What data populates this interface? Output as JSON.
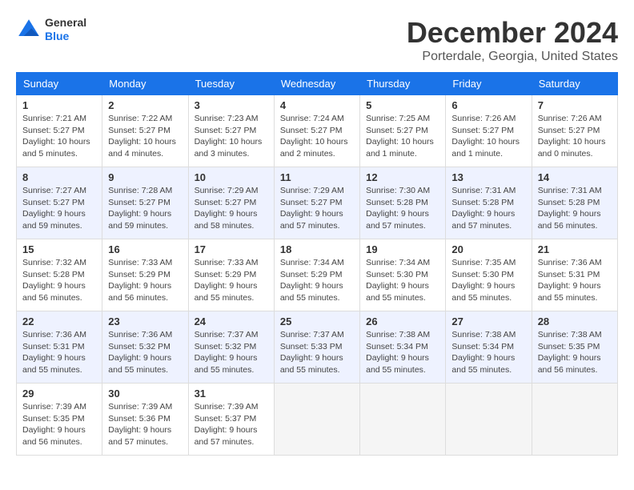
{
  "header": {
    "logo_line1": "General",
    "logo_line2": "Blue",
    "month_title": "December 2024",
    "location": "Porterdale, Georgia, United States"
  },
  "days_of_week": [
    "Sunday",
    "Monday",
    "Tuesday",
    "Wednesday",
    "Thursday",
    "Friday",
    "Saturday"
  ],
  "weeks": [
    [
      {
        "day": "1",
        "sunrise": "Sunrise: 7:21 AM",
        "sunset": "Sunset: 5:27 PM",
        "daylight": "Daylight: 10 hours and 5 minutes."
      },
      {
        "day": "2",
        "sunrise": "Sunrise: 7:22 AM",
        "sunset": "Sunset: 5:27 PM",
        "daylight": "Daylight: 10 hours and 4 minutes."
      },
      {
        "day": "3",
        "sunrise": "Sunrise: 7:23 AM",
        "sunset": "Sunset: 5:27 PM",
        "daylight": "Daylight: 10 hours and 3 minutes."
      },
      {
        "day": "4",
        "sunrise": "Sunrise: 7:24 AM",
        "sunset": "Sunset: 5:27 PM",
        "daylight": "Daylight: 10 hours and 2 minutes."
      },
      {
        "day": "5",
        "sunrise": "Sunrise: 7:25 AM",
        "sunset": "Sunset: 5:27 PM",
        "daylight": "Daylight: 10 hours and 1 minute."
      },
      {
        "day": "6",
        "sunrise": "Sunrise: 7:26 AM",
        "sunset": "Sunset: 5:27 PM",
        "daylight": "Daylight: 10 hours and 1 minute."
      },
      {
        "day": "7",
        "sunrise": "Sunrise: 7:26 AM",
        "sunset": "Sunset: 5:27 PM",
        "daylight": "Daylight: 10 hours and 0 minutes."
      }
    ],
    [
      {
        "day": "8",
        "sunrise": "Sunrise: 7:27 AM",
        "sunset": "Sunset: 5:27 PM",
        "daylight": "Daylight: 9 hours and 59 minutes."
      },
      {
        "day": "9",
        "sunrise": "Sunrise: 7:28 AM",
        "sunset": "Sunset: 5:27 PM",
        "daylight": "Daylight: 9 hours and 59 minutes."
      },
      {
        "day": "10",
        "sunrise": "Sunrise: 7:29 AM",
        "sunset": "Sunset: 5:27 PM",
        "daylight": "Daylight: 9 hours and 58 minutes."
      },
      {
        "day": "11",
        "sunrise": "Sunrise: 7:29 AM",
        "sunset": "Sunset: 5:27 PM",
        "daylight": "Daylight: 9 hours and 57 minutes."
      },
      {
        "day": "12",
        "sunrise": "Sunrise: 7:30 AM",
        "sunset": "Sunset: 5:28 PM",
        "daylight": "Daylight: 9 hours and 57 minutes."
      },
      {
        "day": "13",
        "sunrise": "Sunrise: 7:31 AM",
        "sunset": "Sunset: 5:28 PM",
        "daylight": "Daylight: 9 hours and 57 minutes."
      },
      {
        "day": "14",
        "sunrise": "Sunrise: 7:31 AM",
        "sunset": "Sunset: 5:28 PM",
        "daylight": "Daylight: 9 hours and 56 minutes."
      }
    ],
    [
      {
        "day": "15",
        "sunrise": "Sunrise: 7:32 AM",
        "sunset": "Sunset: 5:28 PM",
        "daylight": "Daylight: 9 hours and 56 minutes."
      },
      {
        "day": "16",
        "sunrise": "Sunrise: 7:33 AM",
        "sunset": "Sunset: 5:29 PM",
        "daylight": "Daylight: 9 hours and 56 minutes."
      },
      {
        "day": "17",
        "sunrise": "Sunrise: 7:33 AM",
        "sunset": "Sunset: 5:29 PM",
        "daylight": "Daylight: 9 hours and 55 minutes."
      },
      {
        "day": "18",
        "sunrise": "Sunrise: 7:34 AM",
        "sunset": "Sunset: 5:29 PM",
        "daylight": "Daylight: 9 hours and 55 minutes."
      },
      {
        "day": "19",
        "sunrise": "Sunrise: 7:34 AM",
        "sunset": "Sunset: 5:30 PM",
        "daylight": "Daylight: 9 hours and 55 minutes."
      },
      {
        "day": "20",
        "sunrise": "Sunrise: 7:35 AM",
        "sunset": "Sunset: 5:30 PM",
        "daylight": "Daylight: 9 hours and 55 minutes."
      },
      {
        "day": "21",
        "sunrise": "Sunrise: 7:36 AM",
        "sunset": "Sunset: 5:31 PM",
        "daylight": "Daylight: 9 hours and 55 minutes."
      }
    ],
    [
      {
        "day": "22",
        "sunrise": "Sunrise: 7:36 AM",
        "sunset": "Sunset: 5:31 PM",
        "daylight": "Daylight: 9 hours and 55 minutes."
      },
      {
        "day": "23",
        "sunrise": "Sunrise: 7:36 AM",
        "sunset": "Sunset: 5:32 PM",
        "daylight": "Daylight: 9 hours and 55 minutes."
      },
      {
        "day": "24",
        "sunrise": "Sunrise: 7:37 AM",
        "sunset": "Sunset: 5:32 PM",
        "daylight": "Daylight: 9 hours and 55 minutes."
      },
      {
        "day": "25",
        "sunrise": "Sunrise: 7:37 AM",
        "sunset": "Sunset: 5:33 PM",
        "daylight": "Daylight: 9 hours and 55 minutes."
      },
      {
        "day": "26",
        "sunrise": "Sunrise: 7:38 AM",
        "sunset": "Sunset: 5:34 PM",
        "daylight": "Daylight: 9 hours and 55 minutes."
      },
      {
        "day": "27",
        "sunrise": "Sunrise: 7:38 AM",
        "sunset": "Sunset: 5:34 PM",
        "daylight": "Daylight: 9 hours and 55 minutes."
      },
      {
        "day": "28",
        "sunrise": "Sunrise: 7:38 AM",
        "sunset": "Sunset: 5:35 PM",
        "daylight": "Daylight: 9 hours and 56 minutes."
      }
    ],
    [
      {
        "day": "29",
        "sunrise": "Sunrise: 7:39 AM",
        "sunset": "Sunset: 5:35 PM",
        "daylight": "Daylight: 9 hours and 56 minutes."
      },
      {
        "day": "30",
        "sunrise": "Sunrise: 7:39 AM",
        "sunset": "Sunset: 5:36 PM",
        "daylight": "Daylight: 9 hours and 57 minutes."
      },
      {
        "day": "31",
        "sunrise": "Sunrise: 7:39 AM",
        "sunset": "Sunset: 5:37 PM",
        "daylight": "Daylight: 9 hours and 57 minutes."
      },
      null,
      null,
      null,
      null
    ]
  ]
}
